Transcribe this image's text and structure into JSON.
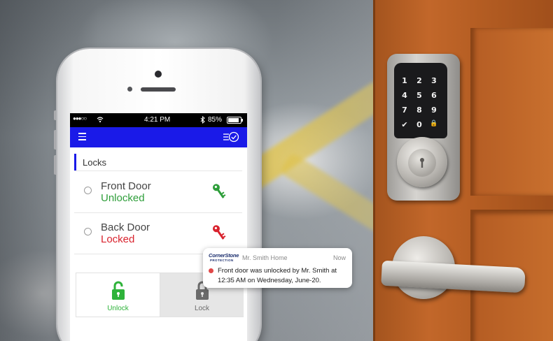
{
  "status_bar": {
    "signal": "●●●○○",
    "time": "4:21 PM",
    "battery": "85%"
  },
  "app_bar": {
    "menu_icon": "hamburger-icon",
    "filter_icon": "checklist-filter-icon",
    "color": "#1a1ae8"
  },
  "section": {
    "title": "Locks"
  },
  "locks": [
    {
      "name": "Front Door",
      "status": "Unlocked",
      "status_color": "#2e9e3a",
      "key_icon_color": "#2e9e3a"
    },
    {
      "name": "Back Door",
      "status": "Locked",
      "status_color": "#d9232e",
      "key_icon_color": "#d9232e"
    }
  ],
  "actions": {
    "unlock_label": "Unlock",
    "lock_label": "Lock",
    "unlock_color": "#2eb33a",
    "lock_color": "#6b6b6b"
  },
  "notification": {
    "logo_main": "CornerStone",
    "logo_sub": "PROTECTION",
    "app_name": "Mr. Smith Home",
    "time": "Now",
    "message": "Front door was unlocked by Mr. Smith at 12:35 AM on Wednesday, June-20."
  },
  "keypad": {
    "keys": [
      "1",
      "2",
      "3",
      "4",
      "5",
      "6",
      "7",
      "8",
      "9",
      "✔",
      "0",
      "🔒"
    ]
  }
}
